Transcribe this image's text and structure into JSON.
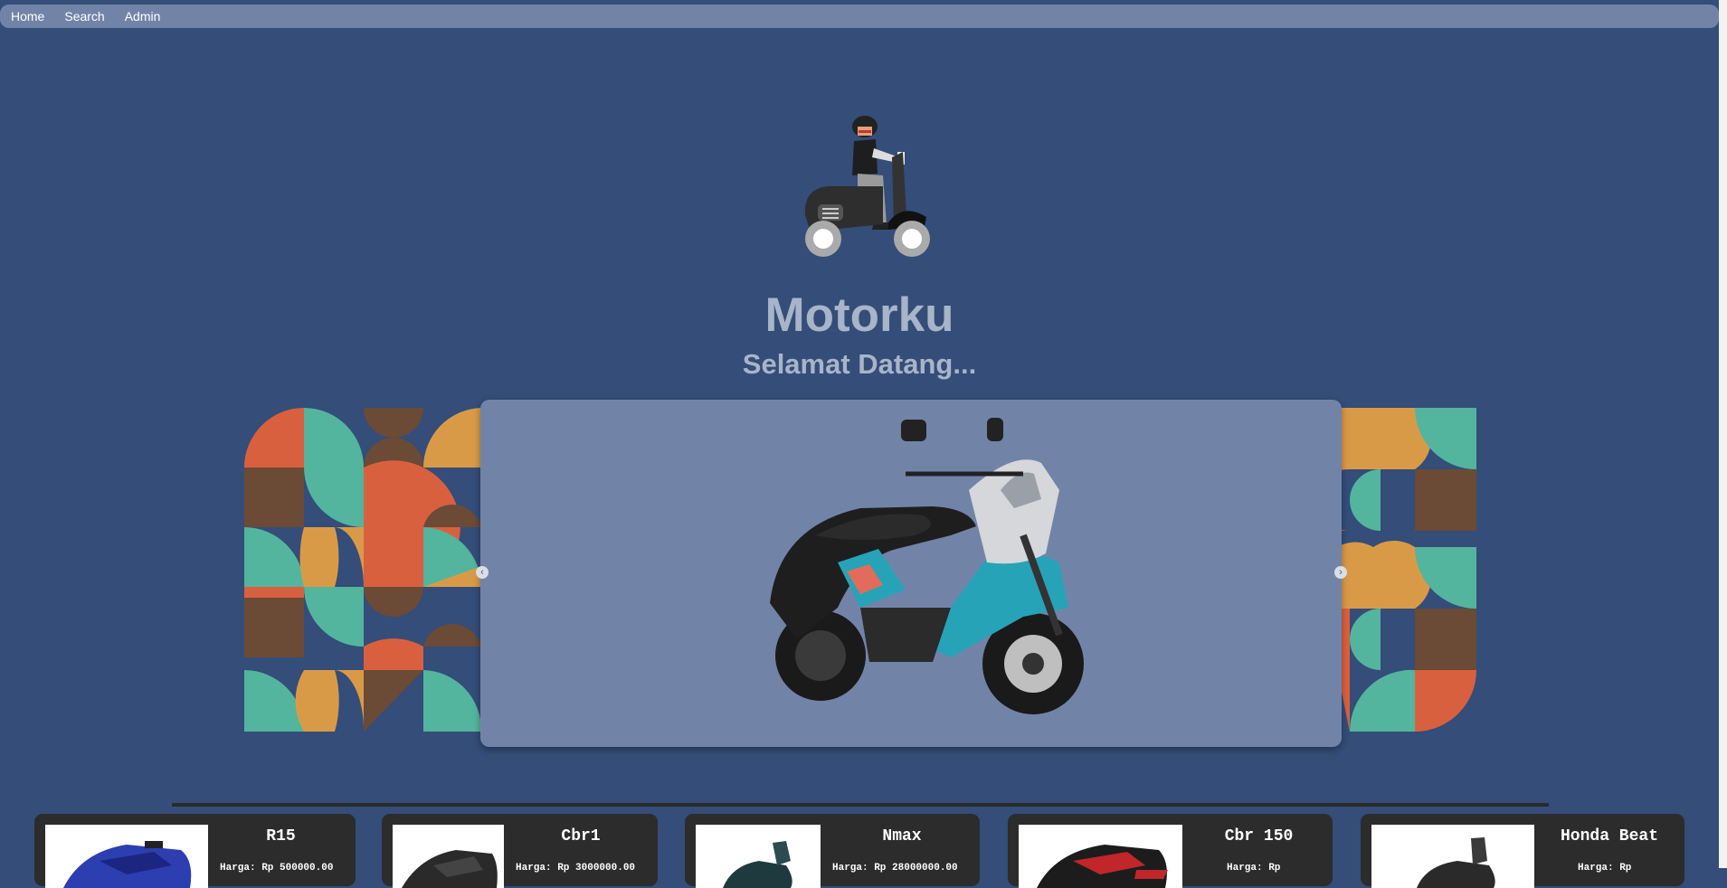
{
  "nav": {
    "items": [
      {
        "label": "Home"
      },
      {
        "label": "Search"
      },
      {
        "label": "Admin"
      }
    ]
  },
  "hero": {
    "logo_icon": "scooter-rider-icon",
    "title": "Motorku",
    "subtitle": "Selamat Datang..."
  },
  "carousel": {
    "slide_image": "blue-scooter-image",
    "prev_icon": "chevron-left-icon",
    "next_icon": "chevron-right-icon"
  },
  "colors": {
    "background": "#344d79",
    "navbar": "#7184a8",
    "card": "#2c2c2c",
    "pattern_orange": "#d9603e",
    "pattern_teal": "#53b59e",
    "pattern_brown": "#6b4a36",
    "pattern_gold": "#d99a48"
  },
  "products": [
    {
      "name": "R15",
      "price": "Harga: Rp 500000.00"
    },
    {
      "name": "Cbr1",
      "price": "Harga: Rp 3000000.00"
    },
    {
      "name": "Nmax",
      "price": "Harga: Rp 28000000.00"
    },
    {
      "name": "Cbr 150",
      "price": "Harga: Rp"
    },
    {
      "name": "Honda Beat",
      "price": "Harga: Rp"
    }
  ]
}
